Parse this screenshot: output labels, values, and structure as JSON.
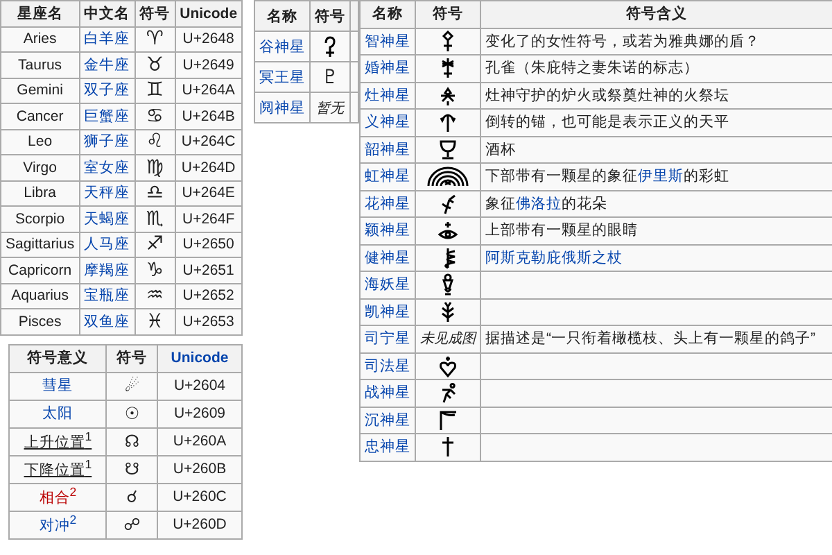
{
  "zodiac_table": {
    "columns": [
      "星座名",
      "中文名",
      "符号",
      "Unicode"
    ],
    "rows": [
      {
        "name": "Aries",
        "chinese": "白羊座",
        "symbol": "♈",
        "code": "U+2648"
      },
      {
        "name": "Taurus",
        "chinese": "金牛座",
        "symbol": "♉",
        "code": "U+2649"
      },
      {
        "name": "Gemini",
        "chinese": "双子座",
        "symbol": "♊",
        "code": "U+264A"
      },
      {
        "name": "Cancer",
        "chinese": "巨蟹座",
        "symbol": "♋",
        "code": "U+264B"
      },
      {
        "name": "Leo",
        "chinese": "狮子座",
        "symbol": "♌",
        "code": "U+264C"
      },
      {
        "name": "Virgo",
        "chinese": "室女座",
        "symbol": "♍",
        "code": "U+264D"
      },
      {
        "name": "Libra",
        "chinese": "天秤座",
        "symbol": "♎",
        "code": "U+264E"
      },
      {
        "name": "Scorpio",
        "chinese": "天蝎座",
        "symbol": "♏",
        "code": "U+264F"
      },
      {
        "name": "Sagittarius",
        "chinese": "人马座",
        "symbol": "♐",
        "code": "U+2650"
      },
      {
        "name": "Capricorn",
        "chinese": "摩羯座",
        "symbol": "♑",
        "code": "U+2651"
      },
      {
        "name": "Aquarius",
        "chinese": "宝瓶座",
        "symbol": "♒",
        "code": "U+2652"
      },
      {
        "name": "Pisces",
        "chinese": "双鱼座",
        "symbol": "♓",
        "code": "U+2653"
      }
    ]
  },
  "other_symbols_table": {
    "columns": [
      {
        "label": "符号意义",
        "link": false
      },
      {
        "label": "符号",
        "link": false
      },
      {
        "label": "Unicode",
        "link": true
      }
    ],
    "rows": [
      {
        "meaning": "彗星",
        "kind": "link",
        "symbol": "☄",
        "code": "U+2604"
      },
      {
        "meaning": "太阳",
        "kind": "link",
        "symbol": "☉",
        "code": "U+2609"
      },
      {
        "meaning": "上升位置$^{1}$",
        "kind": "dark",
        "symbol": "☊",
        "code": "U+260A"
      },
      {
        "meaning": "下降位置$^{1}$",
        "kind": "dark",
        "symbol": "☋",
        "code": "U+260B"
      },
      {
        "meaning": "相合$^{2}$",
        "kind": "redlink",
        "symbol": "☌",
        "code": "U+260C"
      },
      {
        "meaning": "对冲$^{2}$",
        "kind": "link",
        "symbol": "☍",
        "code": "U+260D"
      }
    ]
  },
  "dwarf_table": {
    "columns": [
      "名称",
      "符号"
    ],
    "rows": [
      {
        "name": "谷神星"
      },
      {
        "name": "冥王星",
        "symbol": "♇"
      },
      {
        "name": "阋神星",
        "symbol_text": "暂无"
      }
    ]
  },
  "asteroid_table": {
    "columns": [
      "名称",
      "符号",
      "符号含义"
    ],
    "rows": [
      {
        "name": "智神星",
        "description": [
          {
            "text": "变化了的女性符号，或若为雅典娜的盾？",
            "link": false
          }
        ]
      },
      {
        "name": "婚神星",
        "description": [
          {
            "text": "孔雀（朱庇特之妻朱诺的标志）",
            "link": false
          }
        ]
      },
      {
        "name": "灶神星",
        "description": [
          {
            "text": "灶神守护的炉火或祭奠灶神的火祭坛",
            "link": false
          }
        ]
      },
      {
        "name": "义神星",
        "description": [
          {
            "text": "倒转的锚，也可能是表示正义的天平",
            "link": false
          }
        ]
      },
      {
        "name": "韶神星",
        "description": [
          {
            "text": "酒杯",
            "link": false
          }
        ]
      },
      {
        "name": "虹神星",
        "description": [
          {
            "text": "下部带有一颗星的象征",
            "link": false
          },
          {
            "text": "伊里斯",
            "link": true
          },
          {
            "text": "的彩虹",
            "link": false
          }
        ]
      },
      {
        "name": "花神星",
        "description": [
          {
            "text": "象征",
            "link": false
          },
          {
            "text": "佛洛拉",
            "link": true
          },
          {
            "text": "的花朵",
            "link": false
          }
        ]
      },
      {
        "name": "颖神星",
        "description": [
          {
            "text": "上部带有一颗星的眼睛",
            "link": false
          }
        ]
      },
      {
        "name": "健神星",
        "description": [
          {
            "text": "阿斯克勒庇俄斯之杖",
            "link": true
          }
        ]
      },
      {
        "name": "海妖星"
      },
      {
        "name": "凯神星"
      },
      {
        "name": "司宁星",
        "symbol_text": "未见成图",
        "description": [
          {
            "text": "据描述是“一只衔着橄榄枝、头上有一颗星的鸽子”",
            "link": false
          }
        ]
      },
      {
        "name": "司法星"
      },
      {
        "name": "战神星"
      },
      {
        "name": "沉神星"
      },
      {
        "name": "忠神星"
      }
    ]
  }
}
